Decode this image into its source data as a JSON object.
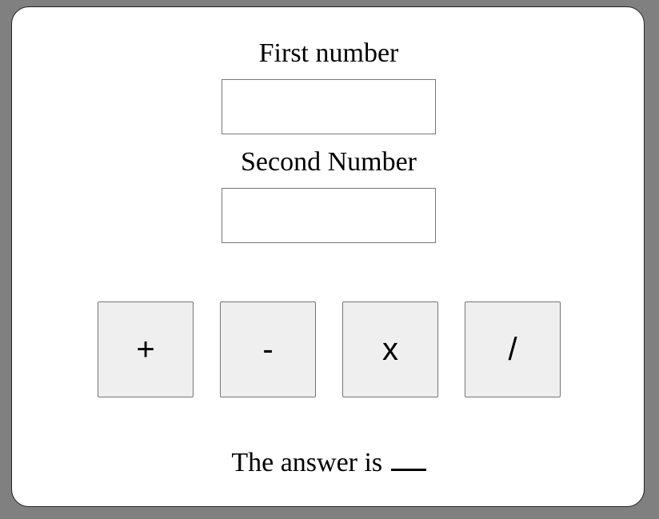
{
  "form": {
    "first_label": "First number",
    "first_value": "",
    "second_label": "Second Number",
    "second_value": ""
  },
  "operations": {
    "add_label": "+",
    "subtract_label": "-",
    "multiply_label": "x",
    "divide_label": "/"
  },
  "result": {
    "prefix": "The answer is",
    "value": ""
  },
  "colors": {
    "page_background": "#808080",
    "card_background": "#ffffff",
    "button_background": "#efefef"
  }
}
